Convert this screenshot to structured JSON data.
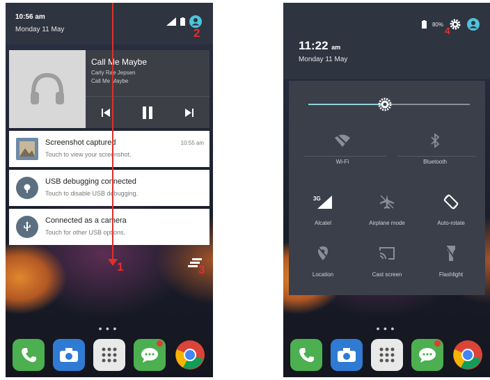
{
  "left_screen": {
    "status_time": "10:56 am",
    "status_date": "Monday 11 May",
    "media": {
      "title": "Call Me Maybe",
      "artist": "Carly Rae Jepsen",
      "album": "Call Me Maybe"
    },
    "notifications": [
      {
        "title": "Screenshot captured",
        "text": "Touch to view your screenshot.",
        "time": "10:55 am",
        "icon": "image-icon"
      },
      {
        "title": "USB debugging connected",
        "text": "Touch to disable USB debugging.",
        "time": "",
        "icon": "bug-icon"
      },
      {
        "title": "Connected as a camera",
        "text": "Touch for other USB options.",
        "time": "",
        "icon": "usb-icon"
      }
    ]
  },
  "right_screen": {
    "battery_percent": "80%",
    "time": "11:22",
    "time_suffix": "am",
    "date": "Monday 11 May",
    "brightness_level": 0.45,
    "tiles": [
      {
        "label": "Wi-Fi",
        "icon": "wifi-off-icon"
      },
      {
        "label": "Bluetooth",
        "icon": "bluetooth-icon"
      },
      {
        "label": "Alcatel",
        "icon": "cell-signal-icon"
      },
      {
        "label": "Airplane mode",
        "icon": "airplane-icon"
      },
      {
        "label": "Auto-rotate",
        "icon": "rotate-icon"
      },
      {
        "label": "Location",
        "icon": "location-off-icon"
      },
      {
        "label": "Cast screen",
        "icon": "cast-icon"
      },
      {
        "label": "Flashlight",
        "icon": "flashlight-icon"
      }
    ]
  },
  "annotations": [
    "1",
    "2",
    "3",
    "4"
  ],
  "colors": {
    "annotation": "#e0302a",
    "accent": "#4fc3d9",
    "notification_bg": "#ffffff"
  }
}
